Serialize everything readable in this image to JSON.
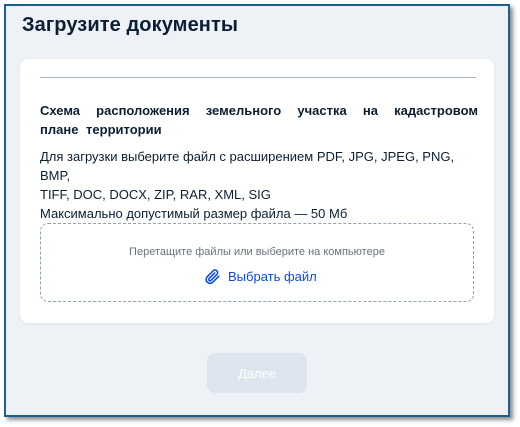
{
  "page": {
    "title": "Загрузите документы"
  },
  "document": {
    "title": "Схема расположения земельного участка на кадастровом плане территории",
    "hint_lines": [
      "Для загрузки выберите файл с расширением PDF, JPG, JPEG, PNG, BMP,",
      "TIFF, DOC, DOCX, ZIP, RAR, XML, SIG",
      "Максимально допустимый размер файла — 50 Мб"
    ]
  },
  "dropzone": {
    "instruction": "Перетащите файлы или выберите на компьютере",
    "choose_label": "Выбрать файл",
    "choose_icon": "paperclip-icon"
  },
  "actions": {
    "next_label": "Далее"
  },
  "colors": {
    "link": "#0d4cd3",
    "text": "#0b1f33",
    "background": "#eef2f7",
    "disabled_button": "#dde5ef"
  }
}
